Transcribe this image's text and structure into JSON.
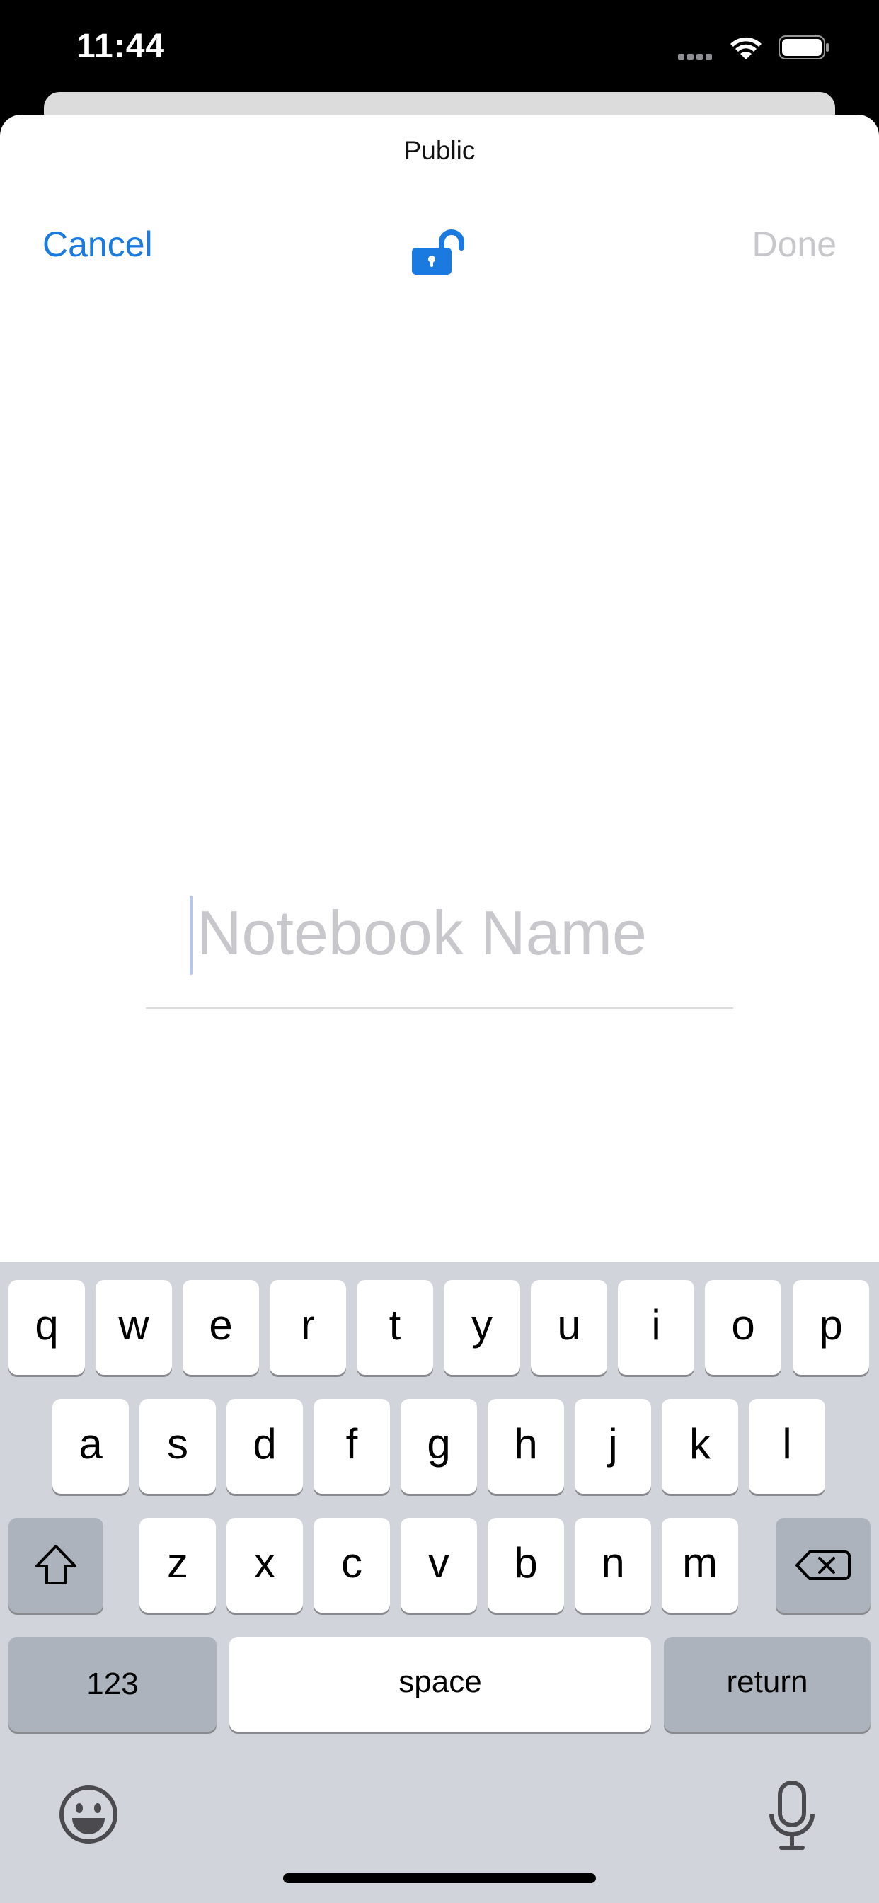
{
  "status_bar": {
    "time": "11:44",
    "icons": [
      "signal-dots-icon",
      "wifi-icon",
      "battery-icon"
    ]
  },
  "sheet": {
    "title": "Public",
    "cancel_label": "Cancel",
    "done_label": "Done",
    "lock_icon": "unlocked-padlock-icon",
    "notebook_name": {
      "value": "",
      "placeholder": "Notebook Name"
    }
  },
  "keyboard": {
    "row1": [
      "q",
      "w",
      "e",
      "r",
      "t",
      "y",
      "u",
      "i",
      "o",
      "p"
    ],
    "row2": [
      "a",
      "s",
      "d",
      "f",
      "g",
      "h",
      "j",
      "k",
      "l"
    ],
    "row3": [
      "z",
      "x",
      "c",
      "v",
      "b",
      "n",
      "m"
    ],
    "numbers_label": "123",
    "space_label": "space",
    "return_label": "return",
    "icons": [
      "shift-icon",
      "backspace-icon",
      "emoji-icon",
      "microphone-icon"
    ]
  },
  "colors": {
    "accent": "#1a7ae0",
    "disabled": "#c8c8cc",
    "keyboard_bg": "#d1d4da",
    "key_dark": "#adb3bc"
  }
}
